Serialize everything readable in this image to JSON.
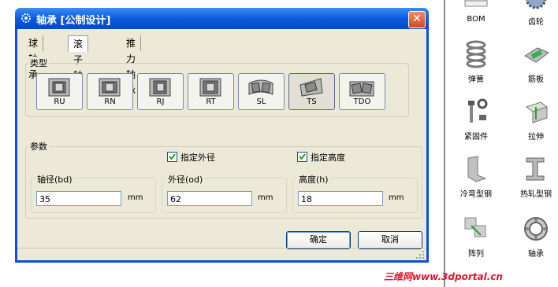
{
  "dialog": {
    "title": "轴承 [公制设计]",
    "close_icon": "close-icon",
    "tabs": [
      "球轴承",
      "滚子轴承",
      "推力轴承"
    ],
    "active_tab": "滚子轴承",
    "type_group_label": "类型",
    "types": [
      "RU",
      "RN",
      "RJ",
      "RT",
      "SL",
      "TS",
      "TDO"
    ],
    "pressed_type": "TS",
    "param_group_label": "参数",
    "specify_od_label": "指定外径",
    "specify_od_checked": true,
    "specify_height_label": "指定高度",
    "specify_height_checked": true,
    "bore": {
      "label": "轴径(bd)",
      "value": "35",
      "unit": "mm"
    },
    "outer": {
      "label": "外径(od)",
      "value": "62",
      "unit": "mm"
    },
    "height": {
      "label": "高度(h)",
      "value": "18",
      "unit": "mm"
    },
    "ok_label": "确定",
    "cancel_label": "取消"
  },
  "palette": [
    {
      "label": "BOM",
      "icon": "bom-icon"
    },
    {
      "label": "齿轮",
      "icon": "gear-icon"
    },
    {
      "label": "弹簧",
      "icon": "spring-icon"
    },
    {
      "label": "筋板",
      "icon": "rib-icon"
    },
    {
      "label": "紧固件",
      "icon": "fastener-icon"
    },
    {
      "label": "拉伸",
      "icon": "extrude-icon"
    },
    {
      "label": "冷弯型钢",
      "icon": "cold-formed-steel-icon"
    },
    {
      "label": "热轧型钢",
      "icon": "hot-rolled-steel-icon"
    },
    {
      "label": "阵列",
      "icon": "array-icon"
    },
    {
      "label": "轴承",
      "icon": "bearing-icon"
    }
  ],
  "watermark": "三维网www.3dportal.cn"
}
